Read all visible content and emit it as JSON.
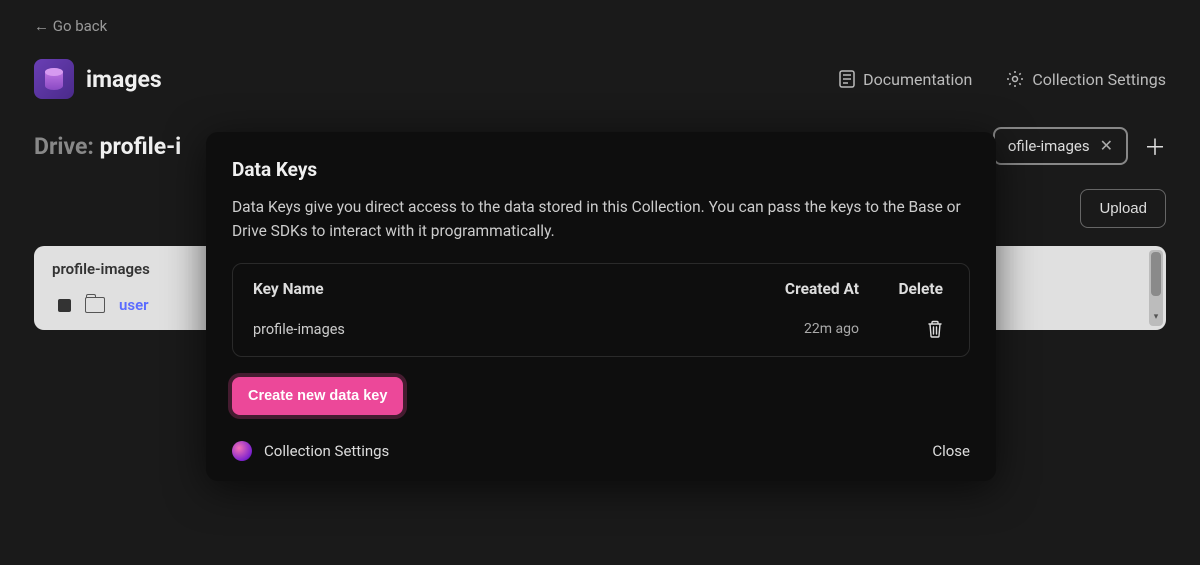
{
  "nav": {
    "go_back": "← Go back"
  },
  "header": {
    "title": "images",
    "documentation": "Documentation",
    "collection_settings": "Collection Settings"
  },
  "breadcrumb": {
    "prefix": "Drive: ",
    "current": "profile-i"
  },
  "tabs": {
    "items": [
      {
        "label": "ofile-images"
      }
    ]
  },
  "toolbar": {
    "upload": "Upload"
  },
  "files": {
    "path_label": "profile-images",
    "rows": [
      {
        "name": "user"
      }
    ]
  },
  "modal": {
    "title": "Data Keys",
    "description": "Data Keys give you direct access to the data stored in this Collection. You can pass the keys to the Base or Drive SDKs to interact with it programmatically.",
    "columns": {
      "name": "Key Name",
      "created": "Created At",
      "delete": "Delete"
    },
    "rows": [
      {
        "name": "profile-images",
        "created": "22m ago"
      }
    ],
    "create_button": "Create new data key",
    "footer_settings": "Collection Settings",
    "close": "Close"
  }
}
